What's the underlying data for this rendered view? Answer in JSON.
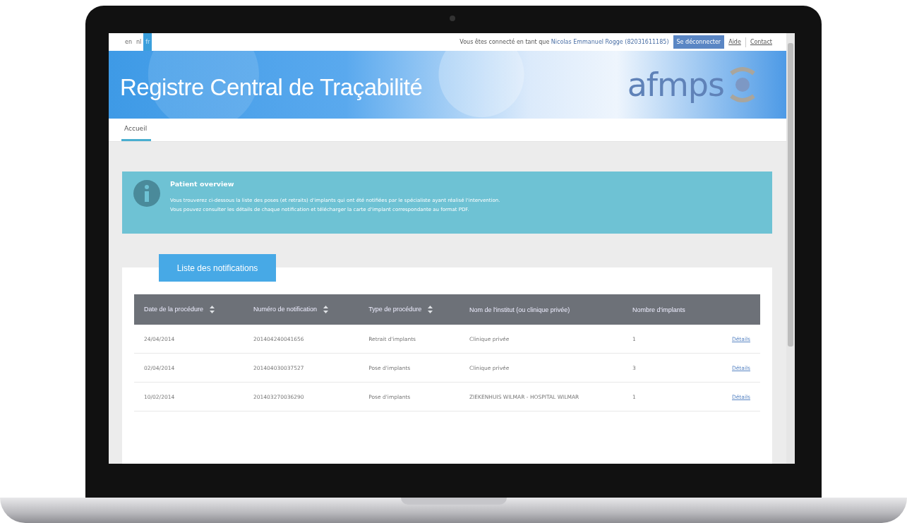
{
  "languages": [
    {
      "label": "en",
      "selected": false
    },
    {
      "label": "nl",
      "selected": false
    },
    {
      "label": "fr",
      "selected": true
    }
  ],
  "user_bar": {
    "prefix": "Vous êtes connecté en tant que",
    "user": "Nicolas Emmanuel Rogge (82031611185)",
    "logout": "Se déconnecter",
    "links": [
      "Aide",
      "Contact"
    ]
  },
  "banner": {
    "title": "Registre Central de Traçabilité",
    "logo": "afmps"
  },
  "nav": [
    {
      "label": "Accueil",
      "selected": true
    }
  ],
  "info": {
    "title": "Patient overview",
    "lines": [
      "Vous trouverez ci-dessous la liste des poses (et retraits) d'implants qui ont été notifiées par le spécialiste ayant réalisé l'intervention.",
      "Vous pouvez consulter les détails de chaque notification et télécharger la carte d'implant correspondante au format PDF."
    ]
  },
  "panel_tab": "Liste des notifications",
  "table": {
    "columns": [
      {
        "label": "Date de la procédure",
        "sortable": true
      },
      {
        "label": "Numéro de notification",
        "sortable": true
      },
      {
        "label": "Type de procédure",
        "sortable": true
      },
      {
        "label": "Nom de l'institut (ou clinique privée)",
        "sortable": false
      },
      {
        "label": "Nombre d'implants",
        "sortable": false
      }
    ],
    "rows": [
      [
        "24/04/2014",
        "201404240041656",
        "Retrait d'implants",
        "Clinique privée",
        "1",
        "Détails"
      ],
      [
        "02/04/2014",
        "201404030037527",
        "Pose d'implants",
        "Clinique privée",
        "3",
        "Détails"
      ],
      [
        "10/02/2014",
        "201403270036290",
        "Pose d'implants",
        "ZIEKENHUIS WILMAR - HOSPITAL WILMAR",
        "1",
        "Détails"
      ]
    ]
  }
}
